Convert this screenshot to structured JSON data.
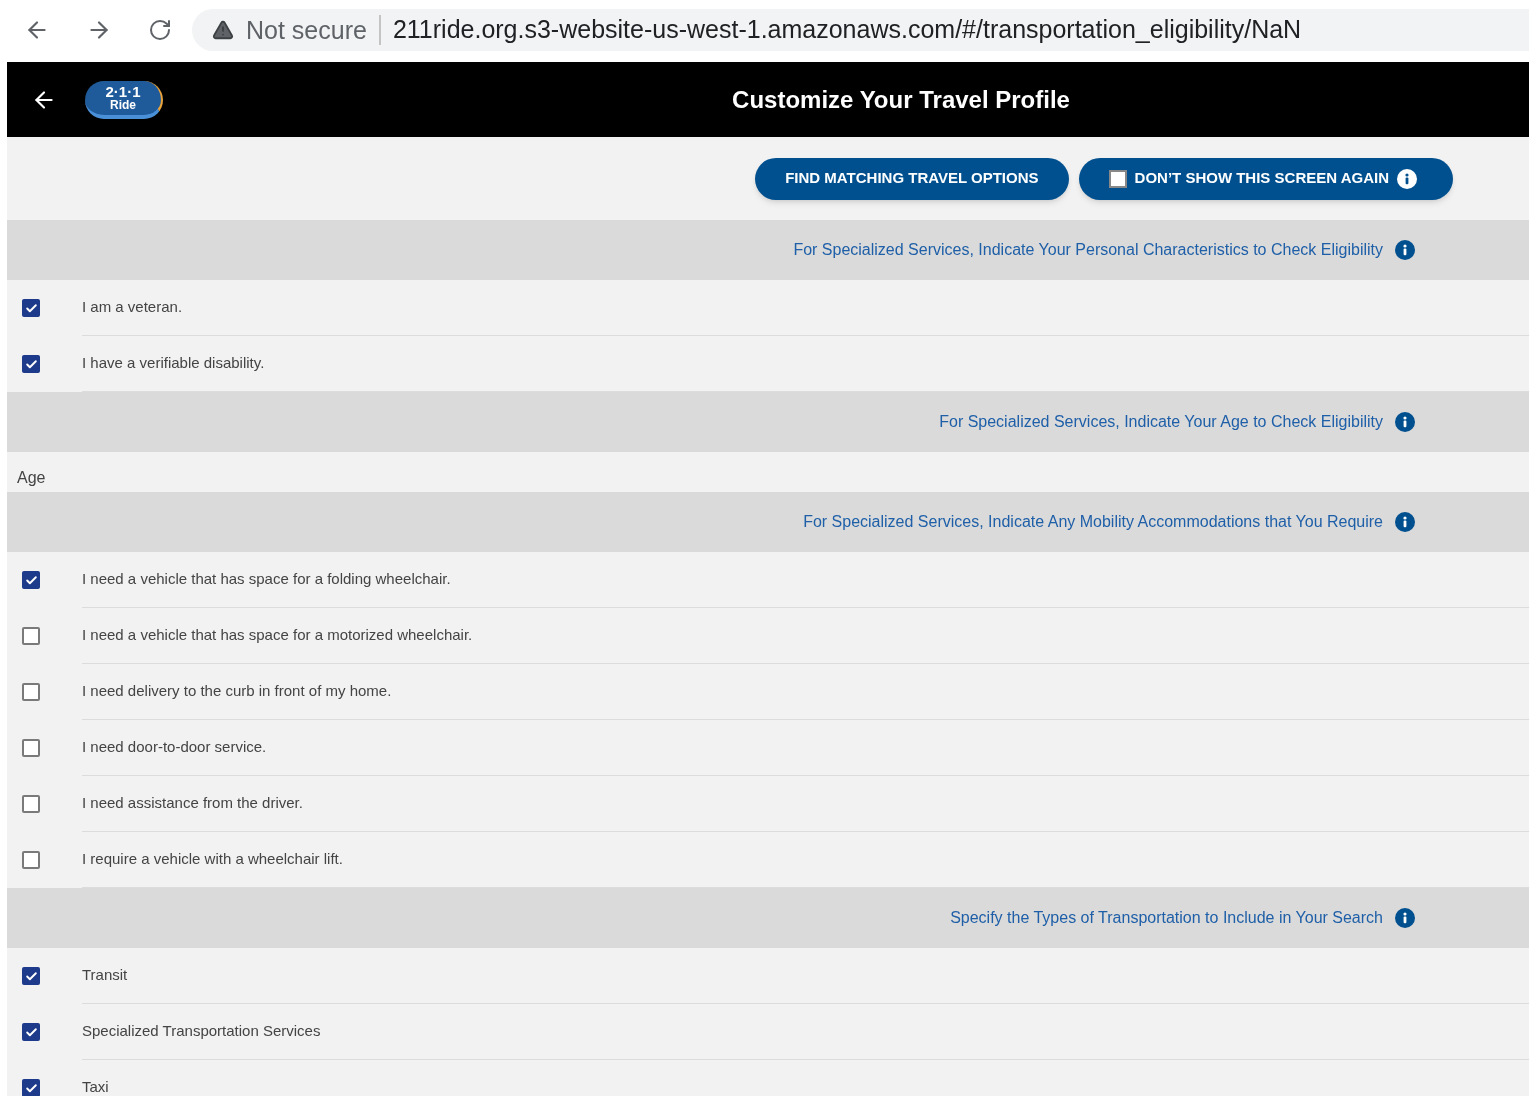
{
  "browser": {
    "security": "Not secure",
    "url": "211ride.org.s3-website-us-west-1.amazonaws.com/#/transportation_eligibility/NaN"
  },
  "header": {
    "logo_top": "2·1·1",
    "logo_bottom": "Ride",
    "title": "Customize Your Travel Profile"
  },
  "actions": {
    "find_button": "FIND MATCHING TRAVEL OPTIONS",
    "dont_show": {
      "label": "DON’T SHOW THIS SCREEN AGAIN",
      "checked": false
    }
  },
  "sections": [
    {
      "heading": "For Specialized Services, Indicate Your Personal Characteristics to Check Eligibility",
      "kind": "checkboxes",
      "items": [
        {
          "label": "I am a veteran.",
          "checked": true
        },
        {
          "label": "I have a verifiable disability.",
          "checked": true
        }
      ]
    },
    {
      "heading": "For Specialized Services, Indicate Your Age to Check Eligibility",
      "kind": "field",
      "label": "Age"
    },
    {
      "heading": "For Specialized Services, Indicate Any Mobility Accommodations that You Require",
      "kind": "checkboxes",
      "items": [
        {
          "label": "I need a vehicle that has space for a folding wheelchair.",
          "checked": true
        },
        {
          "label": "I need a vehicle that has space for a motorized wheelchair.",
          "checked": false
        },
        {
          "label": "I need delivery to the curb in front of my home.",
          "checked": false
        },
        {
          "label": "I need door-to-door service.",
          "checked": false
        },
        {
          "label": "I need assistance from the driver.",
          "checked": false
        },
        {
          "label": "I require a vehicle with a wheelchair lift.",
          "checked": false
        }
      ]
    },
    {
      "heading": "Specify the Types of Transportation to Include in Your Search",
      "kind": "checkboxes",
      "items": [
        {
          "label": "Transit",
          "checked": true
        },
        {
          "label": "Specialized Transportation Services",
          "checked": true
        },
        {
          "label": "Taxi",
          "checked": true
        }
      ]
    }
  ]
}
